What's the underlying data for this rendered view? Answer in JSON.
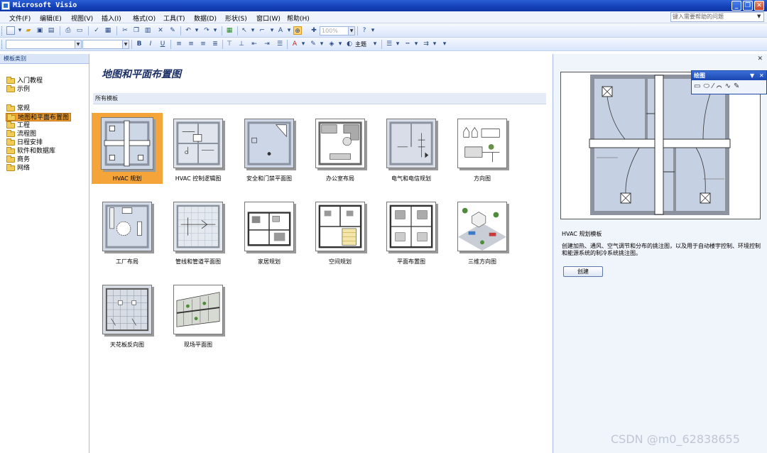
{
  "window": {
    "title": "Microsoft Visio"
  },
  "menubar": {
    "items": [
      "文件(F)",
      "编辑(E)",
      "视图(V)",
      "插入(I)",
      "格式(O)",
      "工具(T)",
      "数据(D)",
      "形状(S)",
      "窗口(W)",
      "帮助(H)"
    ],
    "help_placeholder": "键入需要帮助的问题"
  },
  "toolbar": {
    "zoom": "100%",
    "theme_label": "主题"
  },
  "left_pane": {
    "header": "模板类别",
    "categories": [
      "入门教程",
      "示例",
      "常规",
      "地图和平面布置图",
      "工程",
      "流程图",
      "日程安排",
      "软件和数据库",
      "商务",
      "网络"
    ],
    "selected": "地图和平面布置图"
  },
  "main": {
    "heading": "地图和平面布置图",
    "section": "所有模板",
    "templates": [
      "HVAC 规划",
      "HVAC 控制逻辑图",
      "安全和门禁平面图",
      "办公室布局",
      "电气和电信规划",
      "方向图",
      "工厂布局",
      "管线和管道平面图",
      "家居规划",
      "空间规划",
      "平面布置图",
      "三维方向图",
      "天花板反向图",
      "现场平面图"
    ]
  },
  "preview": {
    "title": "HVAC 规划模板",
    "description": "创建加热、通风、空气调节和分布的挑注图，以及用于自动楼宇控制、环境控制和能源系统的制冷系统挑注图。",
    "create_label": "创建"
  },
  "draw_toolbar": {
    "title": "绘图"
  },
  "watermark": "CSDN @m0_62838655"
}
